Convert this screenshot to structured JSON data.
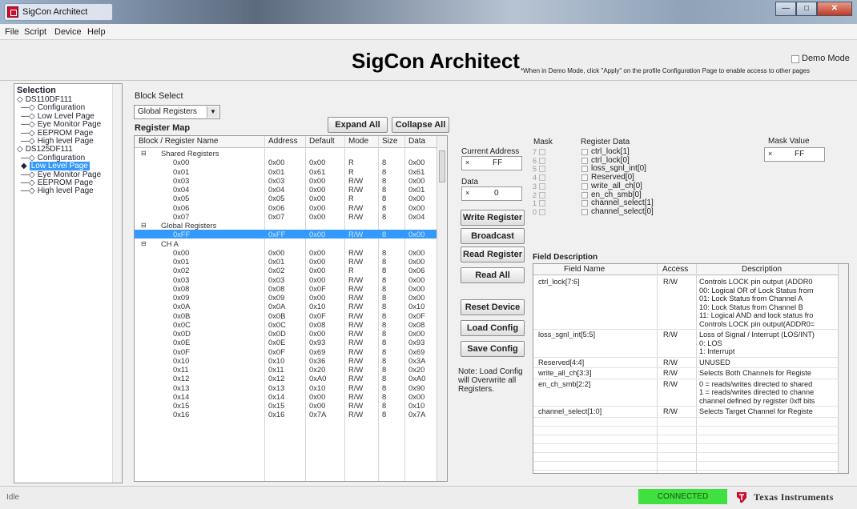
{
  "window": {
    "title": "SigCon Architect"
  },
  "menu": [
    "File",
    "Script",
    "Device",
    "Help"
  ],
  "header": {
    "app_title": "SigCon Architect",
    "demo_note": "*When in Demo Mode, click \"Apply\" on the profile Configuration Page to enable access to other pages",
    "demo_mode_label": "Demo Mode"
  },
  "selection": {
    "title": "Selection",
    "tree": [
      {
        "label": "DS110DF111",
        "level": 0,
        "selected": false
      },
      {
        "label": "Configuration",
        "level": 1,
        "selected": false
      },
      {
        "label": "Low Level Page",
        "level": 1,
        "selected": false
      },
      {
        "label": "Eye Monitor Page",
        "level": 1,
        "selected": false
      },
      {
        "label": "EEPROM Page",
        "level": 1,
        "selected": false
      },
      {
        "label": "High level Page",
        "level": 1,
        "selected": false
      },
      {
        "label": "DS125DF111",
        "level": 0,
        "selected": false
      },
      {
        "label": "Configuration",
        "level": 1,
        "selected": false
      },
      {
        "label": "Low Level Page",
        "level": 1,
        "selected": true
      },
      {
        "label": "Eye Monitor Page",
        "level": 1,
        "selected": false
      },
      {
        "label": "EEPROM Page",
        "level": 1,
        "selected": false
      },
      {
        "label": "High level Page",
        "level": 1,
        "selected": false
      }
    ]
  },
  "block_select": {
    "label": "Block Select",
    "value": "Global Registers"
  },
  "register_map": {
    "label": "Register Map",
    "expand_all": "Expand All",
    "collapse_all": "Collapse All",
    "columns": [
      "Block / Register Name",
      "Address",
      "Default",
      "Mode",
      "Size",
      "Data"
    ],
    "rows": [
      {
        "group": true,
        "name": "Shared Registers"
      },
      {
        "name": "0x00",
        "addr": "0x00",
        "def": "0x00",
        "mode": "R",
        "size": "8",
        "data": "0x00"
      },
      {
        "name": "0x01",
        "addr": "0x01",
        "def": "0x61",
        "mode": "R",
        "size": "8",
        "data": "0x61"
      },
      {
        "name": "0x03",
        "addr": "0x03",
        "def": "0x00",
        "mode": "R/W",
        "size": "8",
        "data": "0x00"
      },
      {
        "name": "0x04",
        "addr": "0x04",
        "def": "0x00",
        "mode": "R/W",
        "size": "8",
        "data": "0x01"
      },
      {
        "name": "0x05",
        "addr": "0x05",
        "def": "0x00",
        "mode": "R",
        "size": "8",
        "data": "0x00"
      },
      {
        "name": "0x06",
        "addr": "0x06",
        "def": "0x00",
        "mode": "R/W",
        "size": "8",
        "data": "0x00"
      },
      {
        "name": "0x07",
        "addr": "0x07",
        "def": "0x00",
        "mode": "R/W",
        "size": "8",
        "data": "0x04"
      },
      {
        "group": true,
        "name": "Global Registers"
      },
      {
        "name": "0xFF",
        "addr": "0xFF",
        "def": "0x00",
        "mode": "R/W",
        "size": "8",
        "data": "0x00",
        "selected": true
      },
      {
        "group": true,
        "name": "CH A"
      },
      {
        "name": "0x00",
        "addr": "0x00",
        "def": "0x00",
        "mode": "R/W",
        "size": "8",
        "data": "0x00"
      },
      {
        "name": "0x01",
        "addr": "0x01",
        "def": "0x00",
        "mode": "R/W",
        "size": "8",
        "data": "0x00"
      },
      {
        "name": "0x02",
        "addr": "0x02",
        "def": "0x00",
        "mode": "R",
        "size": "8",
        "data": "0x06"
      },
      {
        "name": "0x03",
        "addr": "0x03",
        "def": "0x00",
        "mode": "R/W",
        "size": "8",
        "data": "0x00"
      },
      {
        "name": "0x08",
        "addr": "0x08",
        "def": "0x0F",
        "mode": "R/W",
        "size": "8",
        "data": "0x00"
      },
      {
        "name": "0x09",
        "addr": "0x09",
        "def": "0x00",
        "mode": "R/W",
        "size": "8",
        "data": "0x00"
      },
      {
        "name": "0x0A",
        "addr": "0x0A",
        "def": "0x10",
        "mode": "R/W",
        "size": "8",
        "data": "0x10"
      },
      {
        "name": "0x0B",
        "addr": "0x0B",
        "def": "0x0F",
        "mode": "R/W",
        "size": "8",
        "data": "0x0F"
      },
      {
        "name": "0x0C",
        "addr": "0x0C",
        "def": "0x08",
        "mode": "R/W",
        "size": "8",
        "data": "0x08"
      },
      {
        "name": "0x0D",
        "addr": "0x0D",
        "def": "0x00",
        "mode": "R/W",
        "size": "8",
        "data": "0x00"
      },
      {
        "name": "0x0E",
        "addr": "0x0E",
        "def": "0x93",
        "mode": "R/W",
        "size": "8",
        "data": "0x93"
      },
      {
        "name": "0x0F",
        "addr": "0x0F",
        "def": "0x69",
        "mode": "R/W",
        "size": "8",
        "data": "0x69"
      },
      {
        "name": "0x10",
        "addr": "0x10",
        "def": "0x36",
        "mode": "R/W",
        "size": "8",
        "data": "0x3A"
      },
      {
        "name": "0x11",
        "addr": "0x11",
        "def": "0x20",
        "mode": "R/W",
        "size": "8",
        "data": "0x20"
      },
      {
        "name": "0x12",
        "addr": "0x12",
        "def": "0xA0",
        "mode": "R/W",
        "size": "8",
        "data": "0xA0"
      },
      {
        "name": "0x13",
        "addr": "0x13",
        "def": "0x10",
        "mode": "R/W",
        "size": "8",
        "data": "0x90"
      },
      {
        "name": "0x14",
        "addr": "0x14",
        "def": "0x00",
        "mode": "R/W",
        "size": "8",
        "data": "0x00"
      },
      {
        "name": "0x15",
        "addr": "0x15",
        "def": "0x00",
        "mode": "R/W",
        "size": "8",
        "data": "0x10"
      },
      {
        "name": "0x16",
        "addr": "0x16",
        "def": "0x7A",
        "mode": "R/W",
        "size": "8",
        "data": "0x7A"
      }
    ]
  },
  "controls": {
    "current_address_label": "Current Address",
    "current_address_value": "FF",
    "data_label": "Data",
    "data_value": "0",
    "clear_glyph": "×",
    "buttons": [
      "Write Register",
      "Broadcast",
      "Read Register",
      "Read All",
      "Reset Device",
      "Load Config",
      "Save Config"
    ],
    "note": "Note: Load Config will Overwrite all Registers."
  },
  "mask": {
    "mask_label": "Mask",
    "register_data_label": "Register Data",
    "mask_value_label": "Mask Value",
    "mask_value": "FF",
    "bits": [
      {
        "bit": "7",
        "name": "ctrl_lock[1]"
      },
      {
        "bit": "6",
        "name": "ctrl_lock[0]"
      },
      {
        "bit": "5",
        "name": "loss_sgnl_int[0]"
      },
      {
        "bit": "4",
        "name": "Reserved[0]"
      },
      {
        "bit": "3",
        "name": "write_all_ch[0]"
      },
      {
        "bit": "2",
        "name": "en_ch_smb[0]"
      },
      {
        "bit": "1",
        "name": "channel_select[1]"
      },
      {
        "bit": "0",
        "name": "channel_select[0]"
      }
    ]
  },
  "field_description": {
    "label": "Field Description",
    "columns": [
      "Field Name",
      "Access",
      "Description"
    ],
    "rows": [
      {
        "name": "ctrl_lock[7:6]",
        "access": "R/W",
        "desc": [
          "Controls LOCK pin output (ADDR0",
          "00: Logical OR of Lock Status from",
          "01: Lock Status from Channel A",
          "10: Lock Status from Channel B",
          "11: Logical AND and lock status fro",
          "Controls LOCK pin output(ADDR0="
        ]
      },
      {
        "name": "loss_sgnl_int[5:5]",
        "access": "R/W",
        "desc": [
          "Loss of Signal / Interrupt (LOS/INT)",
          "0: LOS",
          "1: Interrupt"
        ]
      },
      {
        "name": "Reserved[4:4]",
        "access": "R/W",
        "desc": [
          "UNUSED"
        ]
      },
      {
        "name": "write_all_ch[3:3]",
        "access": "R/W",
        "desc": [
          "Selects Both Channels for Registe"
        ]
      },
      {
        "name": "en_ch_smb[2:2]",
        "access": "R/W",
        "desc": [
          "0 = reads/writes directed to shared",
          "1 = reads/writes directed to channe",
          "channel defined by register 0xff bits"
        ]
      },
      {
        "name": "channel_select[1:0]",
        "access": "R/W",
        "desc": [
          "Selects Target Channel for Registe"
        ]
      }
    ]
  },
  "status": {
    "text": "Idle",
    "connection": "CONNECTED",
    "brand": "Texas Instruments"
  }
}
